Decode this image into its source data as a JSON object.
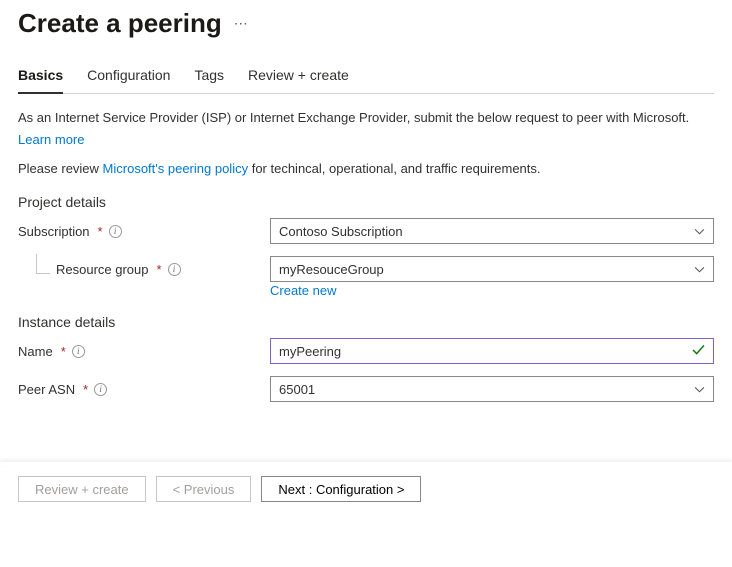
{
  "header": {
    "title": "Create a peering"
  },
  "tabs": [
    {
      "label": "Basics",
      "active": true
    },
    {
      "label": "Configuration",
      "active": false
    },
    {
      "label": "Tags",
      "active": false
    },
    {
      "label": "Review + create",
      "active": false
    }
  ],
  "intro": {
    "text": "As an Internet Service Provider (ISP) or Internet Exchange Provider, submit the below request to peer with Microsoft.",
    "learn_more": "Learn more"
  },
  "policy_sentence": {
    "prefix": "Please review ",
    "link": "Microsoft's peering policy",
    "suffix": " for techincal, operational, and traffic requirements."
  },
  "sections": {
    "project_heading": "Project details",
    "instance_heading": "Instance details"
  },
  "fields": {
    "subscription": {
      "label": "Subscription",
      "value": "Contoso Subscription"
    },
    "resource_group": {
      "label": "Resource group",
      "value": "myResouceGroup",
      "create_new": "Create new"
    },
    "name": {
      "label": "Name",
      "value": "myPeering"
    },
    "peer_asn": {
      "label": "Peer ASN",
      "value": "65001"
    }
  },
  "footer": {
    "review_create": "Review + create",
    "previous": "< Previous",
    "next": "Next : Configuration >"
  }
}
